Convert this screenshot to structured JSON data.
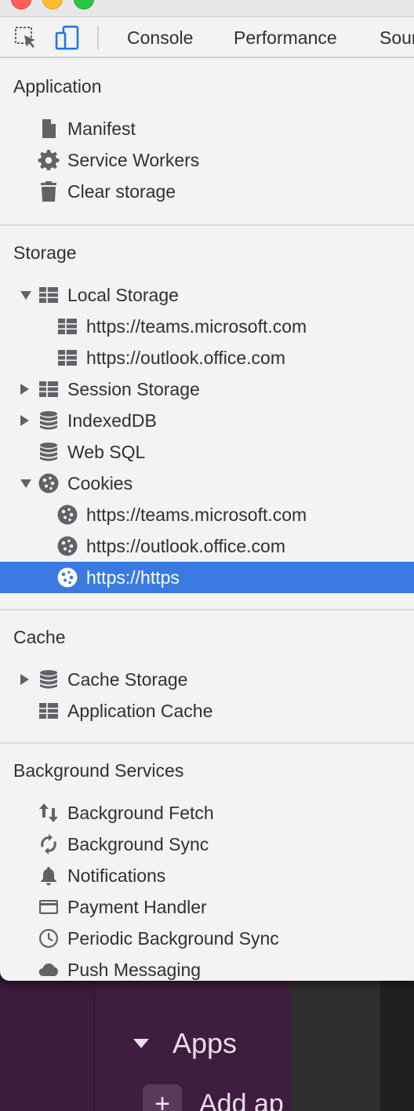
{
  "toolbar": {
    "tabs": [
      "Console",
      "Performance",
      "Sources"
    ]
  },
  "sections": {
    "application": {
      "title": "Application",
      "items": [
        "Manifest",
        "Service Workers",
        "Clear storage"
      ]
    },
    "storage": {
      "title": "Storage",
      "local_storage": "Local Storage",
      "local_children": [
        "https://teams.microsoft.com",
        "https://outlook.office.com"
      ],
      "session_storage": "Session Storage",
      "indexeddb": "IndexedDB",
      "web_sql": "Web SQL",
      "cookies": "Cookies",
      "cookie_children": [
        "https://teams.microsoft.com",
        "https://outlook.office.com",
        "https://https"
      ]
    },
    "cache": {
      "title": "Cache",
      "items": [
        "Cache Storage",
        "Application Cache"
      ]
    },
    "background": {
      "title": "Background Services",
      "items": [
        "Background Fetch",
        "Background Sync",
        "Notifications",
        "Payment Handler",
        "Periodic Background Sync",
        "Push Messaging"
      ]
    }
  },
  "background_app": {
    "apps_label": "Apps",
    "add_label": "Add ap"
  },
  "colors": {
    "selection": "#3b7ae0",
    "panel_bg": "#f3f3f3",
    "device_toolbar_active": "#1a73e8"
  },
  "selected_item": "https://https"
}
